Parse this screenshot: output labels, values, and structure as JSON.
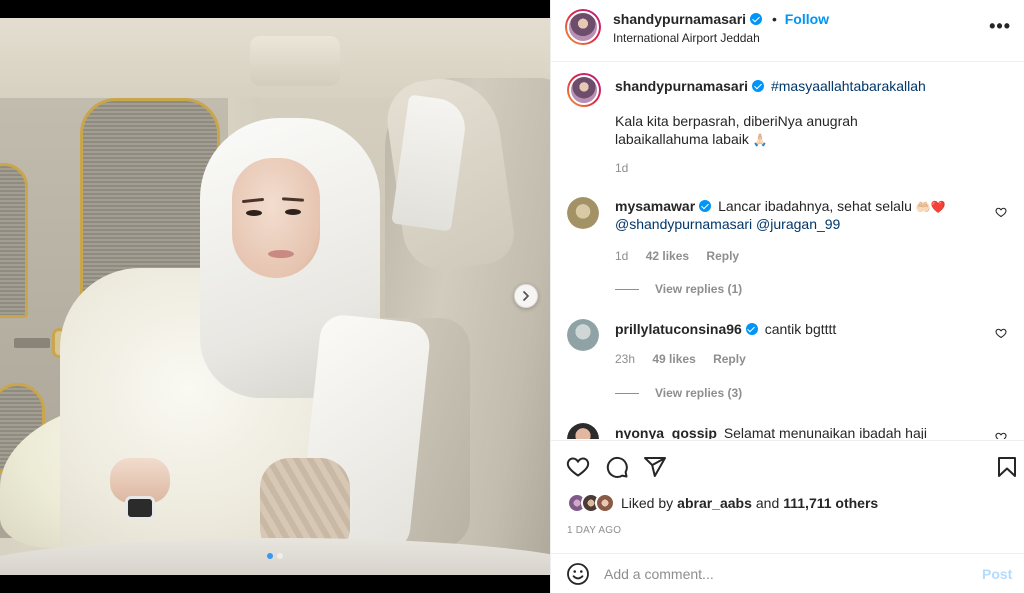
{
  "post": {
    "username": "shandypurnamasari",
    "follow_label": "Follow",
    "location": "International Airport Jeddah",
    "more_label": "•••",
    "carousel": {
      "current": 1,
      "total": 2
    }
  },
  "caption": {
    "username": "shandypurnamasari",
    "hashtag": "#masyaallahtabarakallah",
    "line1": "Kala kita berpasrah, diberiNya anugrah",
    "line2": "labaikallahuma labaik",
    "line2_emoji": "🙏🏻",
    "time": "1d"
  },
  "comments": [
    {
      "username": "mysamawar",
      "text": "Lancar ibadahnya, sehat selalu",
      "emoji": "🤲🏻❤️",
      "mentions": "@shandypurnamasari @juragan_99",
      "time": "1d",
      "likes": "42 likes",
      "reply_label": "Reply",
      "view_replies": "View replies (1)"
    },
    {
      "username": "prillylatuconsina96",
      "text": "cantik bgtttt",
      "time": "23h",
      "likes": "49 likes",
      "reply_label": "Reply",
      "view_replies": "View replies (3)"
    },
    {
      "username": "nyonya_gossip",
      "text": "Selamat menunaikan ibadah haji"
    }
  ],
  "likes": {
    "prefix": "Liked by",
    "user": "abrar_aabs",
    "joiner": "and",
    "count": "111,711 others"
  },
  "posted": "1 DAY AGO",
  "composer": {
    "placeholder": "Add a comment...",
    "post_label": "Post"
  },
  "colors": {
    "link_blue": "#0095f6",
    "mention_blue": "#00376b",
    "muted": "#8e8e8e",
    "post_disabled": "#b3dbff"
  },
  "icons": [
    "emoji-icon",
    "heart-icon",
    "comment-icon",
    "share-icon",
    "bookmark-icon",
    "more-icon",
    "chevron-right-icon",
    "verified-icon"
  ]
}
